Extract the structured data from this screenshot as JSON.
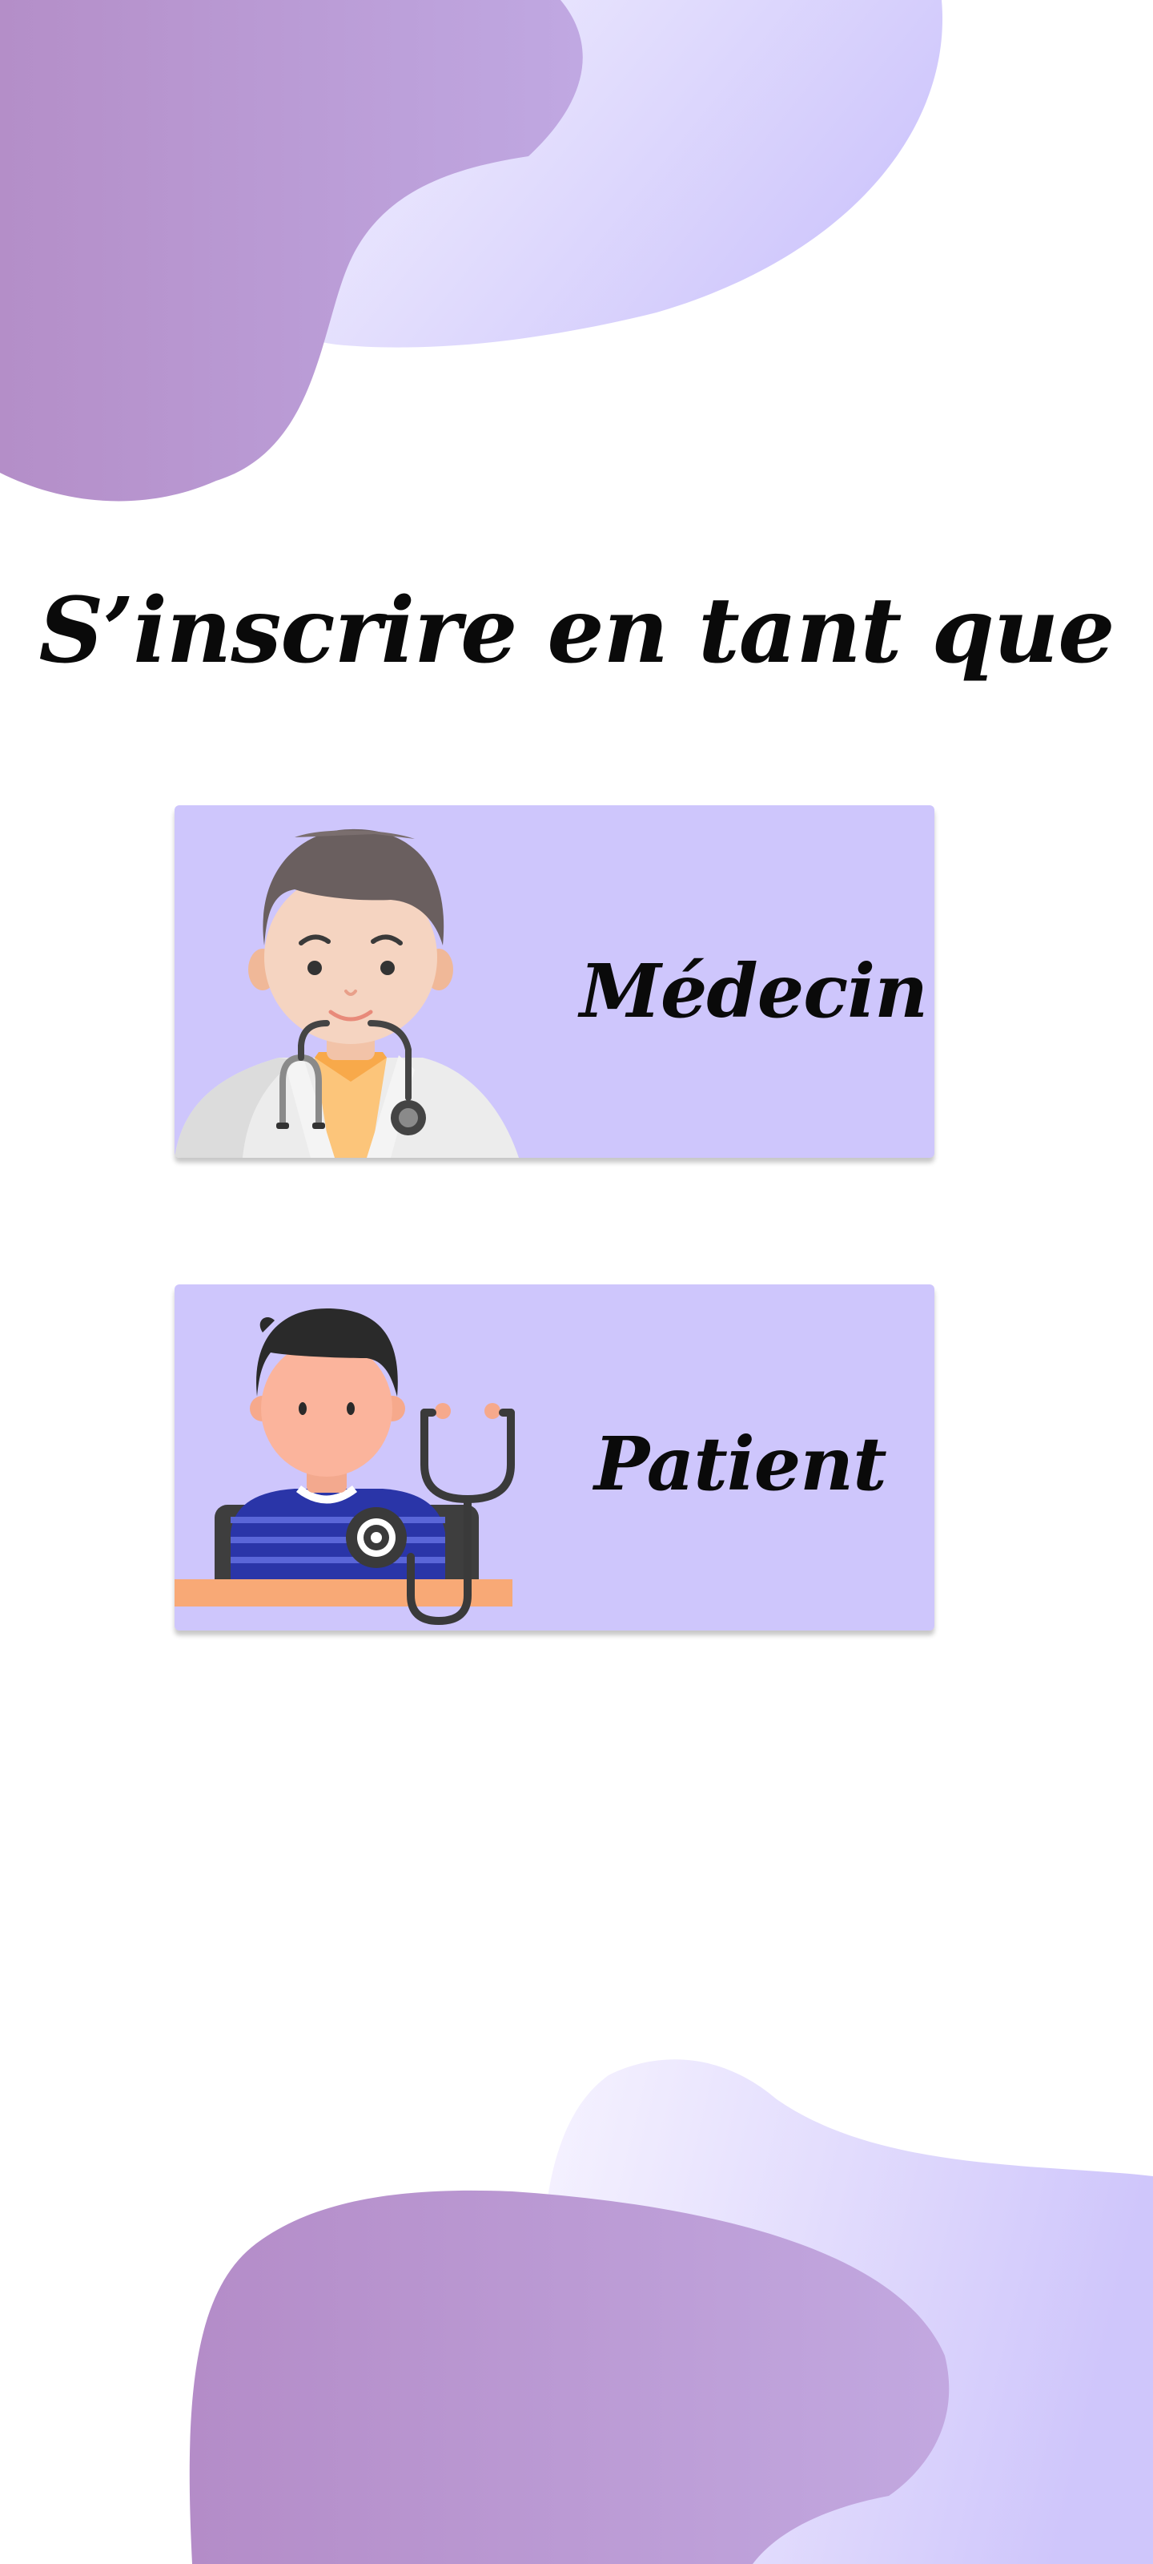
{
  "page": {
    "title": "S’inscrire en tant que"
  },
  "roles": [
    {
      "label": "Médecin",
      "icon": "doctor-icon"
    },
    {
      "label": "Patient",
      "icon": "patient-icon"
    }
  ],
  "colors": {
    "background": "#ffffff",
    "card": "#cec6fc",
    "blob_dark": "#b48ec8",
    "blob_light": "#d4cdfd",
    "text": "#0a0a0a"
  }
}
